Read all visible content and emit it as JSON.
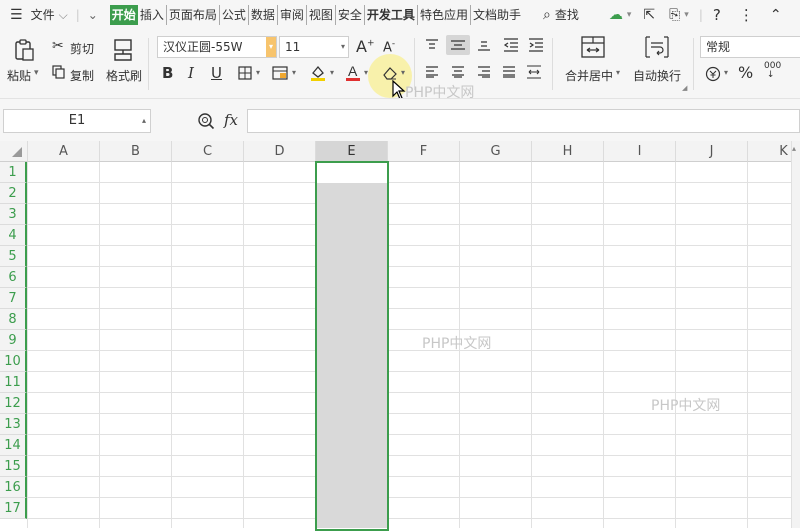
{
  "menubar": {
    "file_label": "文件",
    "tabs": [
      "开始",
      "插入",
      "页面布局",
      "公式",
      "数据",
      "审阅",
      "视图",
      "安全",
      "开发工具",
      "特色应用",
      "文档助手"
    ],
    "search_label": "查找"
  },
  "ribbon": {
    "paste_label": "粘贴",
    "cut_label": "剪切",
    "copy_label": "复制",
    "format_painter_label": "格式刷",
    "font_name": "汉仪正圆-55W",
    "font_size": "11",
    "merge_center_label": "合并居中",
    "wrap_text_label": "自动换行",
    "number_format": "常规"
  },
  "formula_bar": {
    "name_box": "E1",
    "fx_label": "fx",
    "value": ""
  },
  "sheet": {
    "columns": [
      "A",
      "B",
      "C",
      "D",
      "E",
      "F",
      "G",
      "H",
      "I",
      "J",
      "K"
    ],
    "rows": [
      "1",
      "2",
      "3",
      "4",
      "5",
      "6",
      "7",
      "8",
      "9",
      "10",
      "11",
      "12",
      "13",
      "14",
      "15",
      "16",
      "17"
    ],
    "selected_column": "E"
  },
  "watermarks": [
    "PHP中文网",
    "PHP中文网",
    "PHP中文网"
  ],
  "colors": {
    "accent": "#3c9d4d",
    "selection_fill": "#d9d9d9",
    "ribbon_bg": "#f6f6f6"
  }
}
